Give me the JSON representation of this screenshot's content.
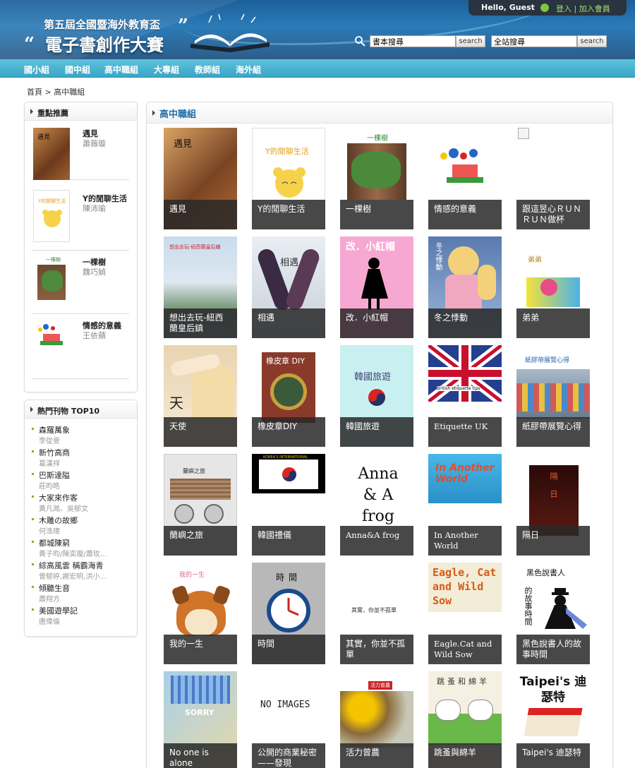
{
  "header": {
    "logo_line1": "第五屆全國暨海外教育盃",
    "logo_line2": "電子書創作大賽",
    "user_greeting": "Hello, Guest",
    "user_links": "登入 | 加入會員",
    "book_search_value": "書本搜尋",
    "book_search_button": "search",
    "site_search_value": "全站搜尋",
    "site_search_button": "search"
  },
  "nav": [
    "國小組",
    "國中組",
    "高中職組",
    "大專組",
    "教師組",
    "海外組"
  ],
  "breadcrumb": "首頁 > 高中職組",
  "featured": {
    "title": "重點推薦",
    "items": [
      {
        "title": "遇見",
        "author": "蕭薇璇"
      },
      {
        "title": "Y的閒聊生活",
        "author": "陳沛瑜"
      },
      {
        "title": "一棵樹",
        "author": "魏巧媜"
      },
      {
        "title": "情感的意義",
        "author": "王依蘋"
      }
    ]
  },
  "top10": {
    "title": "熱門刊物",
    "badge": "TOP10",
    "items": [
      {
        "title": "森羅萬象",
        "author": "李從雯"
      },
      {
        "title": "新竹高商",
        "author": "葛漢祥"
      },
      {
        "title": "巴斯達隘",
        "author": "莊昀晧"
      },
      {
        "title": "大家來作客",
        "author": "黃凡澔、吳郁文"
      },
      {
        "title": "木雕の故鄉",
        "author": "何浩瑋"
      },
      {
        "title": "都城陳窮",
        "author": "黃子昀/陳奕璇/蕭玫..."
      },
      {
        "title": "綜高風雲 稱霸海青",
        "author": "曾郁婷,謝宏明,洪小..."
      },
      {
        "title": "傾聽生音",
        "author": "蕭翔方"
      },
      {
        "title": "美國遊學記",
        "author": "唐偉倫"
      }
    ]
  },
  "main": {
    "title": "高中職組",
    "books": [
      {
        "title": "遇見",
        "cover_text": "遇見"
      },
      {
        "title": "Y的閒聊生活",
        "cover_text": "Y的閒聊生活"
      },
      {
        "title": "一棵樹",
        "cover_text": "一棵樹"
      },
      {
        "title": "情感的意義",
        "cover_text": ""
      },
      {
        "title": "跟這昱心ＲＵＮＲＵＮ做杯",
        "cover_text": ""
      },
      {
        "title": "想出去玩-紐西蘭皇后鎮",
        "cover_text": "想出去玩-紐西蘭皇后鎮"
      },
      {
        "title": "相遇",
        "cover_text": "相遇"
      },
      {
        "title": "改．小紅帽",
        "cover_text": "改．小紅帽"
      },
      {
        "title": "冬之悸動",
        "cover_text": "冬之悸動"
      },
      {
        "title": "弟弟",
        "cover_text": "弟弟"
      },
      {
        "title": "天使",
        "cover_text": "天"
      },
      {
        "title": "橡皮章DIY",
        "cover_text": "橡皮章 DIY"
      },
      {
        "title": "韓國旅遊",
        "cover_text": "韓國旅遊"
      },
      {
        "title": "Etiquette UK",
        "cover_text": "British etiquette tips"
      },
      {
        "title": "紙膠帶展覽心得",
        "cover_text": "紙膠帶展覽心得"
      },
      {
        "title": "蘭嶼之旅",
        "cover_text": "蘭嶼之旅"
      },
      {
        "title": "韓國禮儀",
        "cover_text": "KOREA'S INTERNATIONAL"
      },
      {
        "title": "Anna&A frog",
        "cover_text": "Anna & A frog"
      },
      {
        "title": "In Another World",
        "cover_text": "In Another World"
      },
      {
        "title": "隔日",
        "cover_text": "隔日"
      },
      {
        "title": "我的一生",
        "cover_text": "我的一生"
      },
      {
        "title": "時間",
        "cover_text": "時間"
      },
      {
        "title": "其實，你並不孤單",
        "cover_text": "其實，你並不孤單"
      },
      {
        "title": "Eagle.Cat and Wild Sow",
        "cover_text": "Eagle, Cat and Wild Sow"
      },
      {
        "title": "黑色說書人的故事時間",
        "cover_text": "黑色說書人"
      },
      {
        "title": "No one is alone",
        "cover_text": "SORRY"
      },
      {
        "title": "公開的商業秘密——發現",
        "cover_text": "NO IMAGES"
      },
      {
        "title": "活力曾農",
        "cover_text": "活力曾農"
      },
      {
        "title": "跳蚤與綿羊",
        "cover_text": "跳蚤和綿羊"
      },
      {
        "title": "Taipei's 迪瑟特",
        "cover_text": "Taipei's 迪瑟特"
      }
    ]
  }
}
